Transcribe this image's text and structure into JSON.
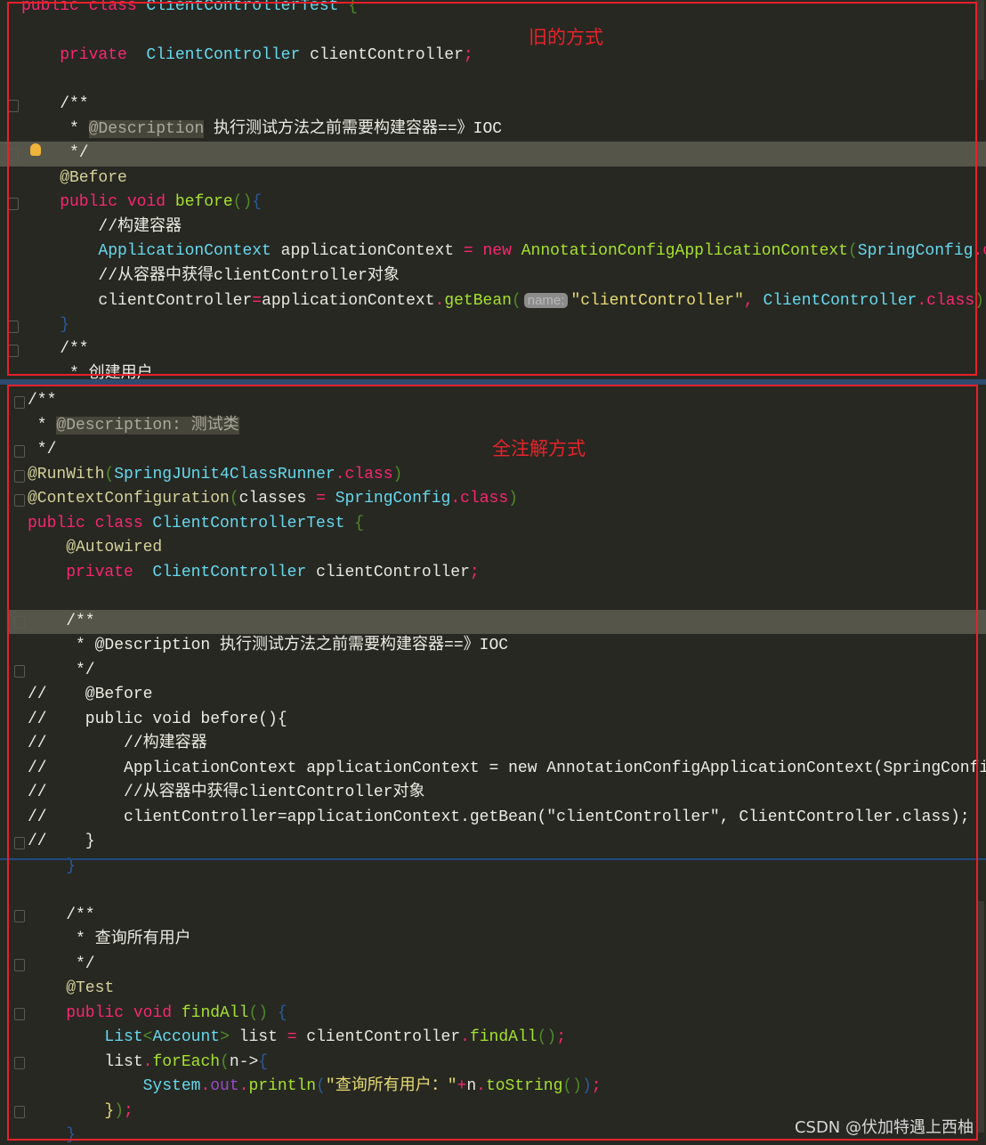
{
  "labels": {
    "old_way": "旧的方式",
    "annotation_way": "全注解方式",
    "watermark": "CSDN @伏加特遇上西柚"
  },
  "colors": {
    "frame": "#e8202a",
    "background": "#272822",
    "keyword": "#f92672",
    "type": "#66d9ef",
    "function": "#a6e22e"
  },
  "top": {
    "lines": [
      [
        [
          "public",
          "kw"
        ],
        [
          " class",
          "kw"
        ],
        [
          " ClientControllerTest",
          "ty"
        ],
        [
          " {",
          "pg"
        ]
      ],
      [],
      [
        [
          "    private",
          "kw"
        ],
        [
          "  ClientController",
          "ty"
        ],
        [
          " clientController",
          "pl"
        ],
        [
          ";",
          "kw"
        ]
      ],
      [],
      [
        [
          "    /**",
          "cm"
        ]
      ],
      [
        [
          "     * ",
          "cm"
        ],
        [
          "@Description",
          "doc"
        ],
        [
          " 执行测试方法之前需要构建容器==》IOC",
          "cm"
        ]
      ],
      [
        [
          "     */",
          "cm"
        ]
      ],
      [
        [
          "    @Before",
          "an"
        ]
      ],
      [
        [
          "    public",
          "kw"
        ],
        [
          " void",
          "kw"
        ],
        [
          " before",
          "fn"
        ],
        [
          "()",
          "pg"
        ],
        [
          "{",
          "br"
        ]
      ],
      [
        [
          "        //构建容器",
          "cm"
        ]
      ],
      [
        [
          "        ApplicationContext",
          "ty"
        ],
        [
          " applicationContext",
          "pl"
        ],
        [
          " =",
          "kw"
        ],
        [
          " new",
          "kw"
        ],
        [
          " AnnotationConfigApplicationContext",
          "fn"
        ],
        [
          "(",
          "pg"
        ],
        [
          "SpringConfig",
          "ty"
        ],
        [
          ".class",
          "kw"
        ],
        [
          ");",
          "pg"
        ]
      ],
      [
        [
          "        //从容器中获得clientController对象",
          "cm"
        ]
      ],
      [
        [
          "        clientController",
          "pl"
        ],
        [
          "=",
          "kw"
        ],
        [
          "applicationContext",
          "pl"
        ],
        [
          ".",
          "kw"
        ],
        [
          "getBean",
          "fn"
        ],
        [
          "(",
          "pg"
        ],
        [
          "name:",
          "hint"
        ],
        [
          "\"clientController\"",
          "str"
        ],
        [
          ",",
          "kw"
        ],
        [
          " ClientController",
          "ty"
        ],
        [
          ".class",
          "kw"
        ],
        [
          ");",
          "pg"
        ]
      ],
      [
        [
          "    }",
          "br"
        ]
      ],
      [
        [
          "    /**",
          "cm"
        ]
      ],
      [
        [
          "     * 创建用户",
          "cm"
        ]
      ]
    ]
  },
  "bottom": {
    "lines": [
      [
        [
          "/**",
          "cm"
        ]
      ],
      [
        [
          " * ",
          "cm"
        ],
        [
          "@Description: 测试类",
          "doc"
        ]
      ],
      [
        [
          " */",
          "cm"
        ]
      ],
      [
        [
          "@RunWith",
          "an"
        ],
        [
          "(",
          "pg"
        ],
        [
          "SpringJUnit4ClassRunner",
          "ty"
        ],
        [
          ".class",
          "kw"
        ],
        [
          ")",
          "pg"
        ]
      ],
      [
        [
          "@ContextConfiguration",
          "an"
        ],
        [
          "(",
          "pg"
        ],
        [
          "classes",
          "pl"
        ],
        [
          " =",
          "kw"
        ],
        [
          " SpringConfig",
          "ty"
        ],
        [
          ".class",
          "kw"
        ],
        [
          ")",
          "pg"
        ]
      ],
      [
        [
          "public",
          "kw"
        ],
        [
          " class",
          "kw"
        ],
        [
          " ClientControllerTest",
          "ty"
        ],
        [
          " {",
          "pg"
        ]
      ],
      [
        [
          "    @Autowired",
          "an"
        ]
      ],
      [
        [
          "    private",
          "kw"
        ],
        [
          "  ClientController",
          "ty"
        ],
        [
          " clientController",
          "pl"
        ],
        [
          ";",
          "kw"
        ]
      ],
      [],
      [
        [
          "    /**",
          "cm"
        ]
      ],
      [
        [
          "     * @Description 执行测试方法之前需要构建容器==》IOC",
          "cm"
        ]
      ],
      [
        [
          "     */",
          "cm"
        ]
      ],
      [
        [
          "//    @Before",
          "cm"
        ]
      ],
      [
        [
          "//    public void before(){",
          "cm"
        ]
      ],
      [
        [
          "//        //构建容器",
          "cm"
        ]
      ],
      [
        [
          "//        ApplicationContext applicationContext = new AnnotationConfigApplicationContext(SpringConfig.class);",
          "cm"
        ]
      ],
      [
        [
          "//        //从容器中获得clientController对象",
          "cm"
        ]
      ],
      [
        [
          "//        clientController=applicationContext.getBean(\"clientController\", ClientController.class);",
          "cm"
        ]
      ],
      [
        [
          "//    }",
          "cm"
        ]
      ],
      [
        [
          "    }",
          "br"
        ]
      ],
      [],
      [
        [
          "    /**",
          "cm"
        ]
      ],
      [
        [
          "     * 查询所有用户",
          "cm"
        ]
      ],
      [
        [
          "     */",
          "cm"
        ]
      ],
      [
        [
          "    @Test",
          "an"
        ]
      ],
      [
        [
          "    public",
          "kw"
        ],
        [
          " void",
          "kw"
        ],
        [
          " findAll",
          "fn"
        ],
        [
          "()",
          "pg"
        ],
        [
          " {",
          "br"
        ]
      ],
      [
        [
          "        List",
          "ty"
        ],
        [
          "<",
          "pg"
        ],
        [
          "Account",
          "ty"
        ],
        [
          ">",
          "pg"
        ],
        [
          " list",
          "pl"
        ],
        [
          " =",
          "kw"
        ],
        [
          " clientController",
          "pl"
        ],
        [
          ".",
          "kw"
        ],
        [
          "findAll",
          "fn"
        ],
        [
          "()",
          "pg"
        ],
        [
          ";",
          "kw"
        ]
      ],
      [
        [
          "        list",
          "pl"
        ],
        [
          ".",
          "kw"
        ],
        [
          "forEach",
          "fn"
        ],
        [
          "(",
          "pg"
        ],
        [
          "n->",
          "pl"
        ],
        [
          "{",
          "br"
        ]
      ],
      [
        [
          "            System",
          "ty"
        ],
        [
          ".",
          "kw"
        ],
        [
          "out",
          "pu"
        ],
        [
          ".",
          "kw"
        ],
        [
          "println",
          "fn"
        ],
        [
          "(",
          "br"
        ],
        [
          "\"查询所有用户：\"",
          "str"
        ],
        [
          "+",
          "kw"
        ],
        [
          "n",
          "pl"
        ],
        [
          ".",
          "kw"
        ],
        [
          "toString",
          "fn"
        ],
        [
          "()",
          "pg"
        ],
        [
          ")",
          "br"
        ],
        [
          ";",
          "kw"
        ]
      ],
      [
        [
          "        }",
          "str"
        ],
        [
          ")",
          "pg"
        ],
        [
          ";",
          "kw"
        ]
      ],
      [
        [
          "    }",
          "br"
        ]
      ]
    ]
  }
}
